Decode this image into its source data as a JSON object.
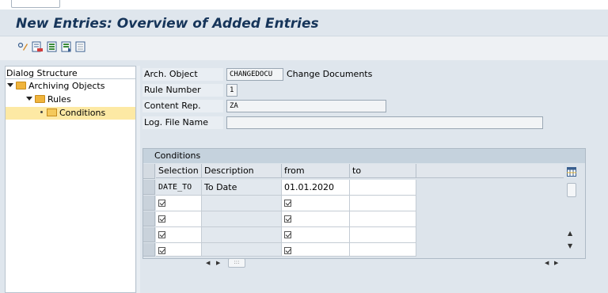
{
  "window": {
    "title": "New Entries: Overview of Added Entries"
  },
  "toolbar": {
    "buttons": [
      {
        "name": "display-change-icon"
      },
      {
        "name": "delete-row-icon"
      },
      {
        "name": "select-all-icon"
      },
      {
        "name": "select-block-icon"
      },
      {
        "name": "deselect-all-icon"
      }
    ]
  },
  "dialog_structure": {
    "title": "Dialog Structure",
    "items": [
      {
        "label": "Archiving Objects",
        "level": 1
      },
      {
        "label": "Rules",
        "level": 2
      },
      {
        "label": "Conditions",
        "level": 3,
        "selected": true
      }
    ]
  },
  "form": {
    "arch_object_label": "Arch. Object",
    "arch_object_value": "CHANGEDOCU",
    "arch_object_desc": "Change Documents",
    "rule_number_label": "Rule Number",
    "rule_number_value": "1",
    "content_rep_label": "Content Rep.",
    "content_rep_value": "ZA",
    "log_file_label": "Log. File Name",
    "log_file_value": ""
  },
  "conditions": {
    "title": "Conditions",
    "columns": [
      "Selection",
      "Description",
      "from",
      "to"
    ],
    "rows": [
      {
        "selection": "DATE_TO",
        "description": "To Date",
        "from": "01.01.2020",
        "to": ""
      },
      {
        "selection": "",
        "description": "",
        "from": "",
        "to": ""
      },
      {
        "selection": "",
        "description": "",
        "from": "",
        "to": ""
      },
      {
        "selection": "",
        "description": "",
        "from": "",
        "to": ""
      },
      {
        "selection": "",
        "description": "",
        "from": "",
        "to": ""
      }
    ],
    "hscroll_thumb": ":::"
  },
  "colors": {
    "title": "#16355a",
    "selected_row": "#fde9a4",
    "folder": "#f0b43c"
  }
}
